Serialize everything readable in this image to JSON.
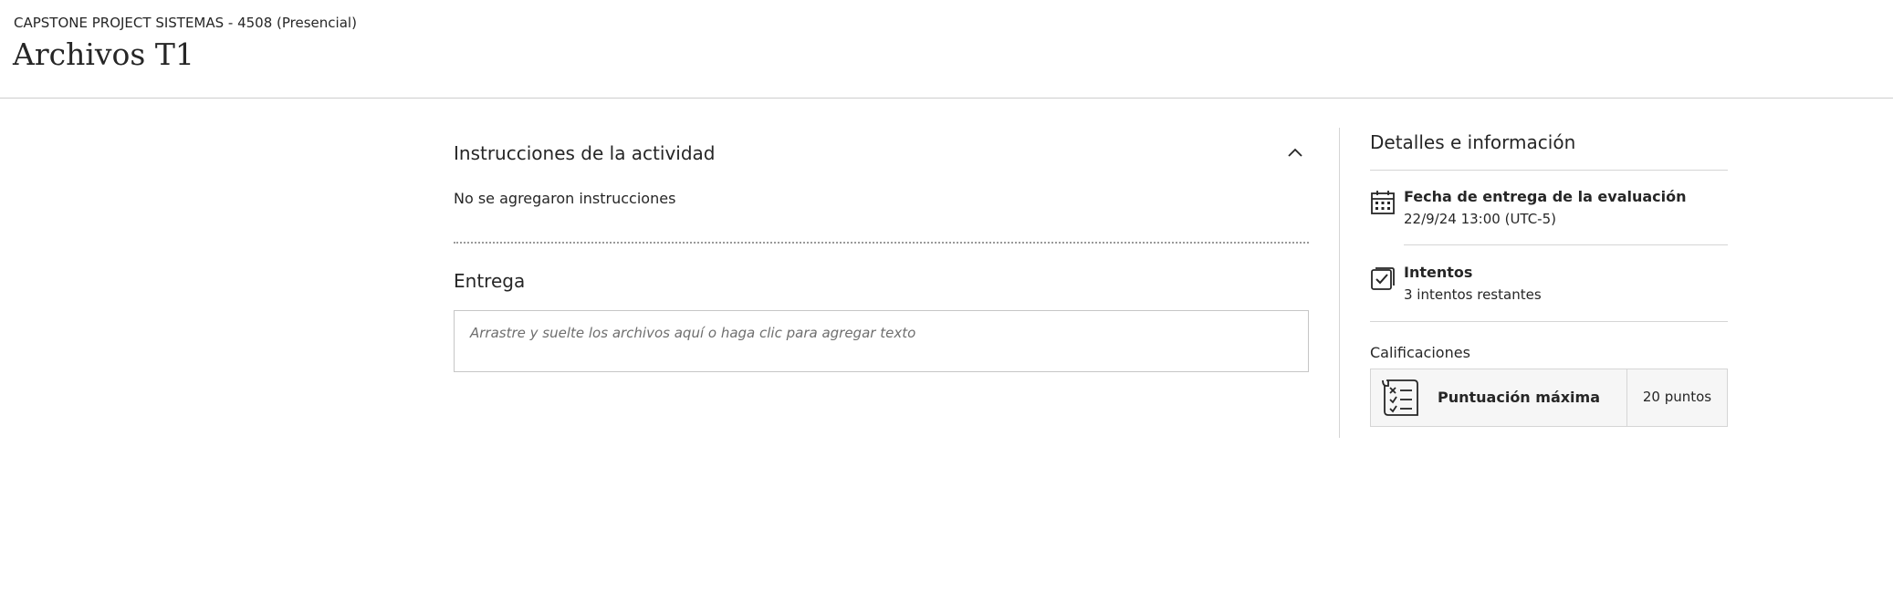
{
  "header": {
    "course": "CAPSTONE PROJECT SISTEMAS - 4508 (Presencial)",
    "title": "Archivos T1"
  },
  "main": {
    "instructions_title": "Instrucciones de la actividad",
    "instructions_text": "No se agregaron instrucciones",
    "collapse_icon": "chevron-up-icon",
    "submission_title": "Entrega",
    "dropzone_placeholder": "Arrastre y suelte los archivos aquí o haga clic para agregar texto"
  },
  "sidebar": {
    "title": "Detalles e información",
    "due": {
      "icon": "calendar-icon",
      "label": "Fecha de entrega de la evaluación",
      "value": "22/9/24 13:00 (UTC-5)"
    },
    "attempts": {
      "icon": "checkbox-icon",
      "label": "Intentos",
      "value": "3 intentos restantes"
    },
    "grades": {
      "label": "Calificaciones",
      "icon": "rubric-checklist-icon",
      "max_label": "Puntuación máxima",
      "max_value": "20 puntos"
    }
  }
}
